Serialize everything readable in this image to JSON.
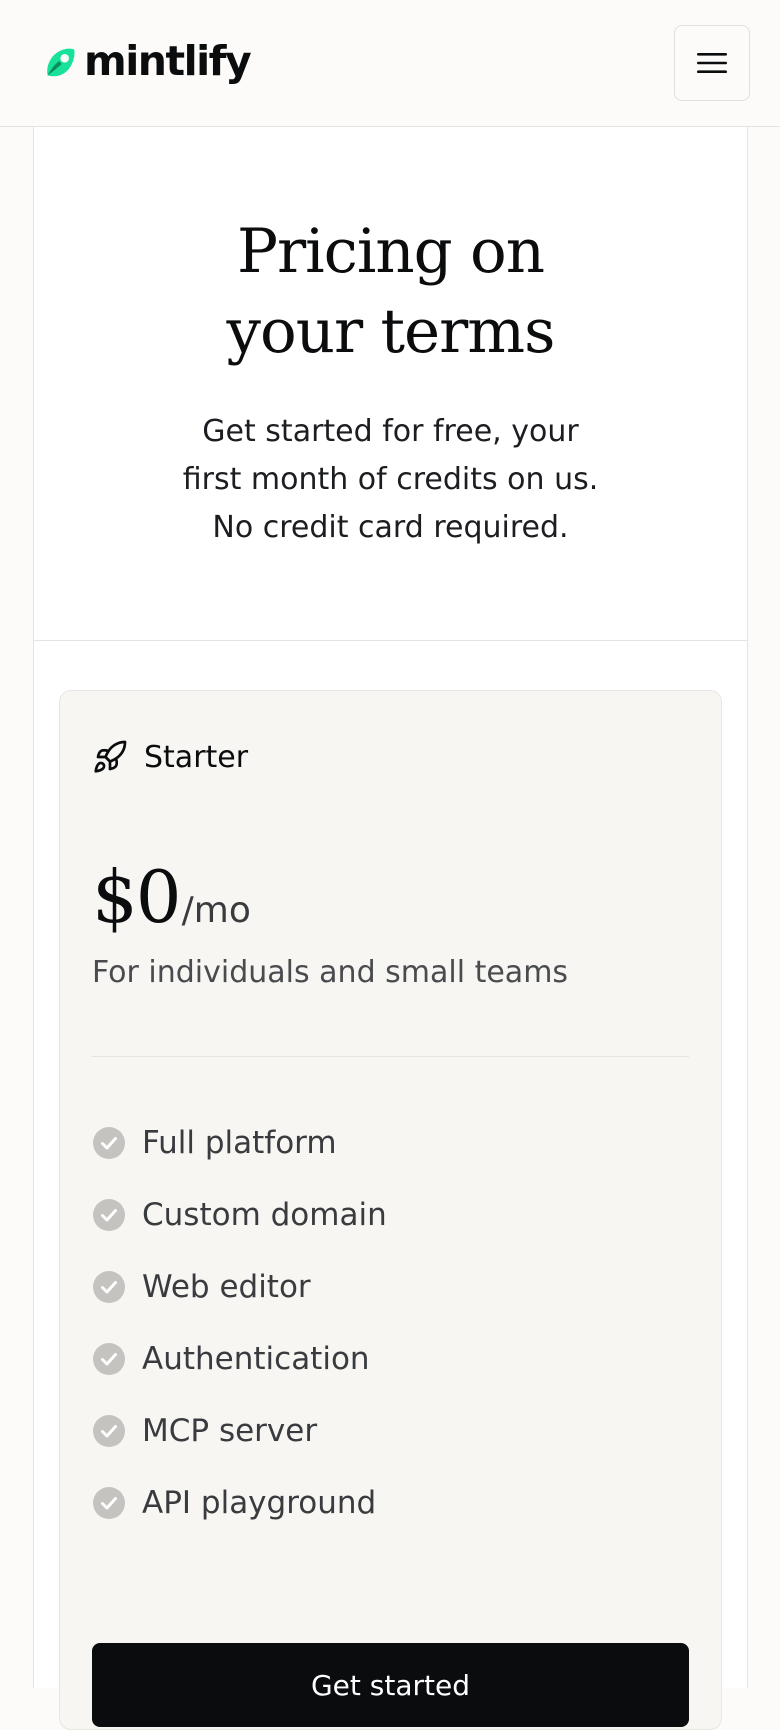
{
  "header": {
    "logo_text": "mintlify",
    "menu_icon": "hamburger-menu-icon",
    "logo_colors": [
      "#18e299",
      "#0c8c5e"
    ]
  },
  "hero": {
    "title_line1": "Pricing on",
    "title_line2": "your terms",
    "subtitle_line1": "Get started for free, your",
    "subtitle_line2": "first month of credits on us.",
    "subtitle_line3": "No credit card required."
  },
  "plan": {
    "icon": "rocket-icon",
    "name": "Starter",
    "price": "$0",
    "period": "/mo",
    "description": "For individuals and small teams",
    "features": [
      "Full platform",
      "Custom domain",
      "Web editor",
      "Authentication",
      "MCP server",
      "API playground"
    ],
    "cta_label": "Get started",
    "check_color": "#c4c3c0"
  }
}
